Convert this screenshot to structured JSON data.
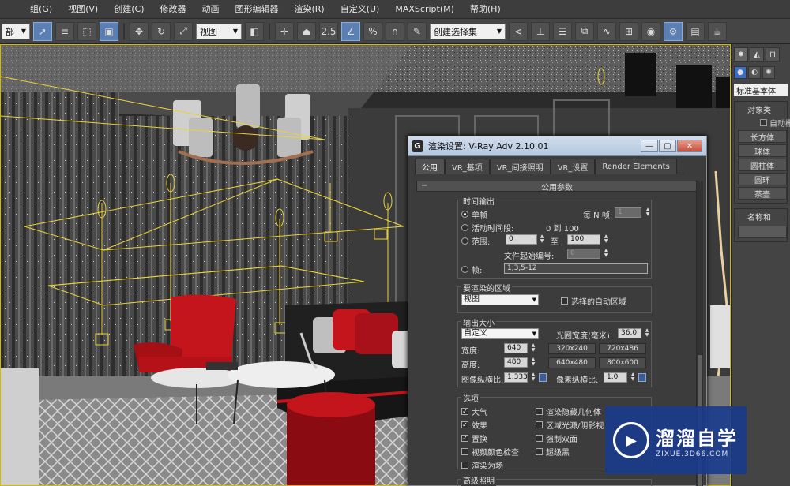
{
  "menubar": {
    "items": [
      "组(G)",
      "视图(V)",
      "创建(C)",
      "修改器",
      "动画",
      "图形编辑器",
      "渲染(R)",
      "自定义(U)",
      "MAXScript(M)",
      "帮助(H)"
    ]
  },
  "toolbar": {
    "selection_filter_value": "部",
    "reference_coord_value": "视图",
    "snap_angle_label": "2.5",
    "percent_snap_label": "%",
    "named_selection_value": "创建选择集"
  },
  "command_panel": {
    "dropdown_value": "标准基本体",
    "object_type_title": "对象类",
    "autogrid_label": "自动栅",
    "object_buttons": [
      "长方体",
      "球体",
      "圆柱体",
      "圆环",
      "茶壶"
    ],
    "name_color_title": "名称和"
  },
  "dialog": {
    "title": "渲染设置: V-Ray Adv 2.10.01",
    "icon_letter": "G",
    "tabs": [
      "公用",
      "VR_基项",
      "VR_间接照明",
      "VR_设置",
      "Render Elements"
    ],
    "rollout_title": "公用参数",
    "time_output": {
      "title": "时间输出",
      "single_label": "单帧",
      "every_nth_label": "每 N 帧:",
      "every_nth_value": "1",
      "active_segment_label": "活动时间段:",
      "active_segment_range": "0 到 100",
      "range_label": "范围:",
      "range_start": "0",
      "range_to": "至",
      "range_end": "100",
      "file_number_label": "文件起始编号:",
      "file_number_value": "0",
      "frames_label": "帧:",
      "frames_value": "1,3,5-12"
    },
    "area": {
      "title": "要渲染的区域",
      "combo_value": "视图",
      "auto_region_label": "选择的自动区域"
    },
    "output_size": {
      "title": "输出大小",
      "combo_value": "自定义",
      "aperture_label": "光圈宽度(毫米):",
      "aperture_value": "36.0",
      "width_label": "宽度:",
      "width_value": "640",
      "height_label": "高度:",
      "height_value": "480",
      "presets": [
        "320x240",
        "720x486",
        "640x480",
        "800x600"
      ],
      "image_aspect_label": "图像纵横比:",
      "image_aspect_value": "1.333",
      "pixel_aspect_label": "像素纵横比:",
      "pixel_aspect_value": "1.0"
    },
    "options": {
      "title": "选项",
      "left": [
        {
          "label": "大气",
          "checked": true
        },
        {
          "label": "效果",
          "checked": true
        },
        {
          "label": "置换",
          "checked": true
        },
        {
          "label": "视频颜色检查",
          "checked": false
        },
        {
          "label": "渲染为场",
          "checked": false
        }
      ],
      "right": [
        {
          "label": "渲染隐藏几何体",
          "checked": false
        },
        {
          "label": "区域光源/阴影视",
          "checked": false
        },
        {
          "label": "强制双面",
          "checked": false
        },
        {
          "label": "超级黑",
          "checked": false
        }
      ]
    },
    "advanced_title": "高级照明"
  },
  "watermark": {
    "main": "溜溜自学",
    "sub": "ZIXUE.3D66.COM"
  },
  "colors": {
    "wire_yellow": "#e8d23a",
    "sofa_red": "#c4141c",
    "accent_blue": "#1a3a8c"
  }
}
